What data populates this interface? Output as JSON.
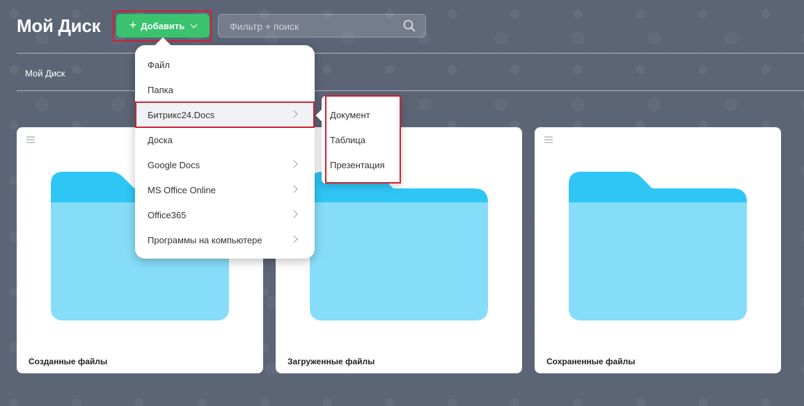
{
  "header": {
    "title": "Мой Диск",
    "add_button_label": "Добавить",
    "search_placeholder": "Фильтр + поиск"
  },
  "breadcrumb": "Мой Диск",
  "cards": [
    {
      "label": "Созданные файлы"
    },
    {
      "label": "Загруженные файлы"
    },
    {
      "label": "Сохраненные файлы"
    }
  ],
  "dropdown": {
    "items": [
      {
        "label": "Файл"
      },
      {
        "label": "Папка"
      },
      {
        "label": "Битрикс24.Docs"
      },
      {
        "label": "Доска"
      },
      {
        "label": "Google Docs"
      },
      {
        "label": "MS Office Online"
      },
      {
        "label": "Office365"
      },
      {
        "label": "Программы на компьютере"
      }
    ]
  },
  "submenu": {
    "items": [
      {
        "label": "Документ"
      },
      {
        "label": "Таблица"
      },
      {
        "label": "Презентация"
      }
    ]
  },
  "colors": {
    "background": "#5b6576",
    "accent_green": "#3bc26e",
    "highlight_red": "#d2202f",
    "folder_dark": "#2fc6f6",
    "folder_light": "#86ddf9"
  },
  "icons": [
    "plus-icon",
    "chevron-down-icon",
    "search-icon",
    "menu-icon",
    "folder-icon",
    "chevron-right-icon"
  ]
}
